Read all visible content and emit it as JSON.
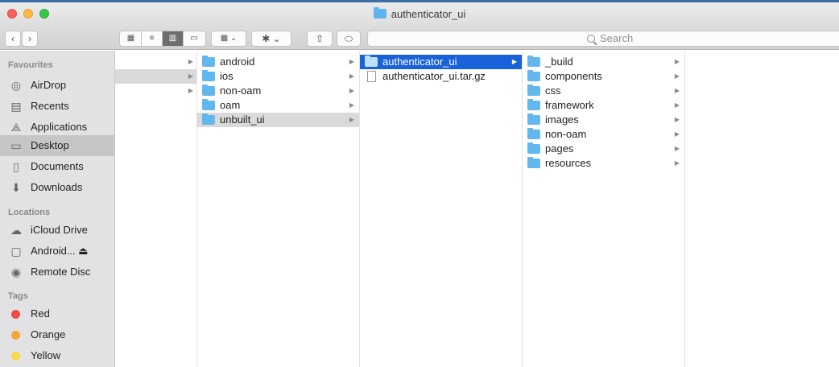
{
  "window": {
    "title": "authenticator_ui"
  },
  "toolbar": {
    "back_label": "‹",
    "forward_label": "›",
    "view_icons": [
      "▦",
      "≡",
      "▥",
      "▭"
    ],
    "arrange_label": "▦ ⌄",
    "action_label": "✱ ⌄",
    "share_label": "⇧",
    "tag_label": "⬭",
    "search_placeholder": "Search"
  },
  "sidebar": {
    "favourites_heading": "Favourites",
    "favourites": [
      {
        "label": "AirDrop",
        "icon": "airdrop-icon",
        "glyph": "◎"
      },
      {
        "label": "Recents",
        "icon": "recents-icon",
        "glyph": "▤"
      },
      {
        "label": "Applications",
        "icon": "applications-icon",
        "glyph": "⟁"
      },
      {
        "label": "Desktop",
        "icon": "desktop-icon",
        "glyph": "▭",
        "selected": true
      },
      {
        "label": "Documents",
        "icon": "documents-icon",
        "glyph": "▯"
      },
      {
        "label": "Downloads",
        "icon": "downloads-icon",
        "glyph": "⬇"
      }
    ],
    "locations_heading": "Locations",
    "locations": [
      {
        "label": "iCloud Drive",
        "icon": "cloud-icon",
        "glyph": "☁"
      },
      {
        "label": "Android... ⏏",
        "icon": "drive-icon",
        "glyph": "▢"
      },
      {
        "label": "Remote Disc",
        "icon": "disc-icon",
        "glyph": "◉"
      }
    ],
    "tags_heading": "Tags",
    "tags": [
      {
        "label": "Red",
        "color": "#ef4b47"
      },
      {
        "label": "Orange",
        "color": "#f6a33c"
      },
      {
        "label": "Yellow",
        "color": "#f8d84a"
      }
    ]
  },
  "columns": {
    "col0": {
      "chevrons": [
        "▶",
        "▶",
        "▶"
      ]
    },
    "col1": [
      {
        "label": "android",
        "kind": "folder"
      },
      {
        "label": "ios",
        "kind": "folder"
      },
      {
        "label": "non-oam",
        "kind": "folder"
      },
      {
        "label": "oam",
        "kind": "folder"
      },
      {
        "label": "unbuilt_ui",
        "kind": "folder",
        "highlighted": true
      }
    ],
    "col2": [
      {
        "label": "authenticator_ui",
        "kind": "folder",
        "selected": true
      },
      {
        "label": "authenticator_ui.tar.gz",
        "kind": "file"
      }
    ],
    "col3": [
      {
        "label": "_build",
        "kind": "folder"
      },
      {
        "label": "components",
        "kind": "folder"
      },
      {
        "label": "css",
        "kind": "folder"
      },
      {
        "label": "framework",
        "kind": "folder"
      },
      {
        "label": "images",
        "kind": "folder"
      },
      {
        "label": "non-oam",
        "kind": "folder"
      },
      {
        "label": "pages",
        "kind": "folder"
      },
      {
        "label": "resources",
        "kind": "folder"
      }
    ],
    "chevron": "▶"
  },
  "colors": {
    "selection": "#1a62d9",
    "folder": "#62b7ef",
    "sidebar_bg": "#e2e2e4"
  }
}
